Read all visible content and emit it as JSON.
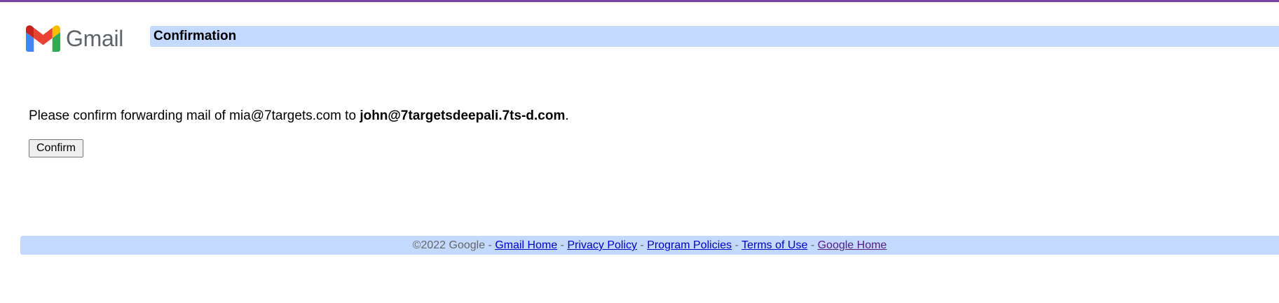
{
  "logo": {
    "text": "Gmail",
    "icon": "gmail-m-icon"
  },
  "header": {
    "title": "Confirmation"
  },
  "message": {
    "prefix": "Please confirm forwarding mail of mia@7targets.com to ",
    "target_email": "john@7targetsdeepali.7ts-d.com",
    "suffix": "."
  },
  "confirm_button": {
    "label": "Confirm"
  },
  "footer": {
    "copyright": "©2022 Google",
    "separator": " - ",
    "links": [
      {
        "label": "Gmail Home"
      },
      {
        "label": "Privacy Policy"
      },
      {
        "label": "Program Policies"
      },
      {
        "label": "Terms of Use"
      },
      {
        "label": "Google Home"
      }
    ]
  },
  "colors": {
    "accent_bar": "#7846a8",
    "header_bg": "#c3d9ff",
    "link": "#0000cc",
    "visited_link": "#551a8b",
    "footer_text": "#666666"
  }
}
